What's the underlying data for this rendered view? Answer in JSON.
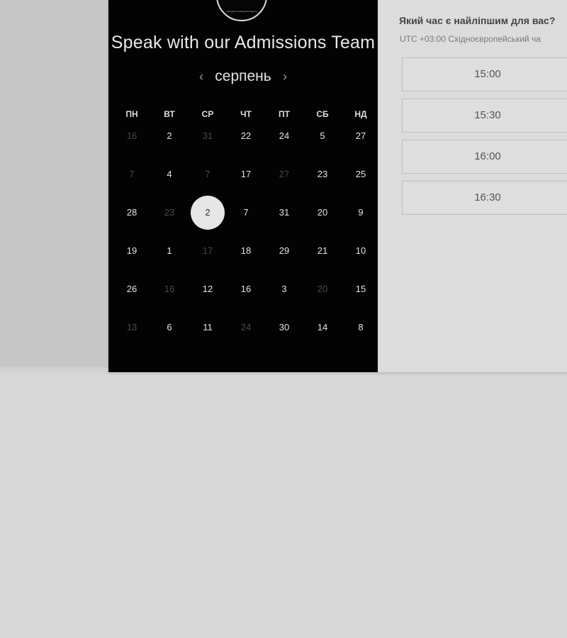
{
  "header": {
    "title": "Speak with our Admissions Team",
    "logo_text": "Visionaries College Reimagined"
  },
  "calendar": {
    "month": "серпень",
    "prev_icon": "chevron-left-icon",
    "next_icon": "chevron-right-icon",
    "weekdays": [
      "ПН",
      "ВТ",
      "СР",
      "ЧТ",
      "ПТ",
      "СБ",
      "НД"
    ],
    "weeks": [
      [
        {
          "label": "16",
          "muted": true
        },
        {
          "label": "2",
          "muted": false
        },
        {
          "label": "31",
          "muted": true
        },
        {
          "label": "22",
          "muted": false
        },
        {
          "label": "24",
          "muted": false
        },
        {
          "label": "5",
          "muted": false
        },
        {
          "label": "27",
          "muted": false
        }
      ],
      [
        {
          "label": "7",
          "muted": true
        },
        {
          "label": "4",
          "muted": false
        },
        {
          "label": "7",
          "muted": true
        },
        {
          "label": "17",
          "muted": false
        },
        {
          "label": "27",
          "muted": true
        },
        {
          "label": "23",
          "muted": false
        },
        {
          "label": "25",
          "muted": false
        }
      ],
      [
        {
          "label": "28",
          "muted": false
        },
        {
          "label": "23",
          "muted": true
        },
        {
          "label": "2",
          "muted": false,
          "selected": true
        },
        {
          "label": "7",
          "muted": false
        },
        {
          "label": "31",
          "muted": false
        },
        {
          "label": "20",
          "muted": false
        },
        {
          "label": "9",
          "muted": false
        }
      ],
      [
        {
          "label": "19",
          "muted": false
        },
        {
          "label": "1",
          "muted": false
        },
        {
          "label": "17",
          "muted": true
        },
        {
          "label": "18",
          "muted": false
        },
        {
          "label": "29",
          "muted": false
        },
        {
          "label": "21",
          "muted": false
        },
        {
          "label": "10",
          "muted": false
        }
      ],
      [
        {
          "label": "26",
          "muted": false
        },
        {
          "label": "16",
          "muted": true
        },
        {
          "label": "12",
          "muted": false
        },
        {
          "label": "16",
          "muted": false
        },
        {
          "label": "3",
          "muted": false
        },
        {
          "label": "20",
          "muted": true
        },
        {
          "label": "15",
          "muted": false
        }
      ],
      [
        {
          "label": "13",
          "muted": true
        },
        {
          "label": "6",
          "muted": false
        },
        {
          "label": "11",
          "muted": false
        },
        {
          "label": "24",
          "muted": true
        },
        {
          "label": "30",
          "muted": false
        },
        {
          "label": "14",
          "muted": false
        },
        {
          "label": "8",
          "muted": false
        }
      ]
    ]
  },
  "time_panel": {
    "title": "Який час є найліпшим для вас?",
    "timezone": "UTC +03:00 Східноєвропейський ча",
    "slots": [
      "15:00",
      "15:30",
      "16:00",
      "16:30"
    ]
  },
  "colors": {
    "calendar_bg": "#030303",
    "time_panel_bg": "#dcdcdc",
    "selected_day_bg": "#e6e6e6",
    "page_bg": "#d8d8d8"
  }
}
